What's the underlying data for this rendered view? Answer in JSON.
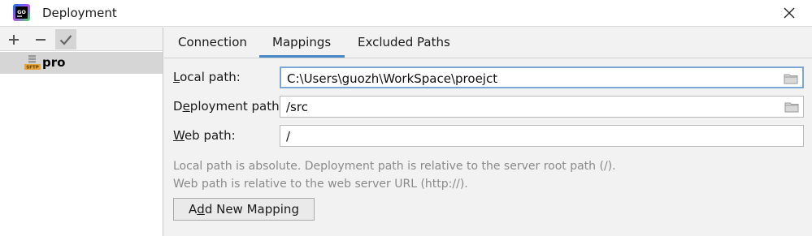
{
  "window": {
    "title": "Deployment",
    "logo_text": "GO",
    "close_icon": "close-icon"
  },
  "sidebar": {
    "toolbar": {
      "add_label": "+",
      "remove_label": "−"
    },
    "servers": [
      {
        "label": "pro",
        "badge": "SFTP"
      }
    ]
  },
  "tabs": [
    {
      "label": "Connection"
    },
    {
      "label": "Mappings"
    },
    {
      "label": "Excluded Paths"
    }
  ],
  "active_tab": "Mappings",
  "mappings": {
    "local_path": {
      "label_prefix": "",
      "mnemonic": "L",
      "label_rest": "ocal path:",
      "value": "C:\\Users\\guozh\\WorkSpace\\proejct"
    },
    "deployment_path": {
      "label_prefix": "D",
      "mnemonic": "e",
      "label_rest": "ployment path:",
      "value": "/src"
    },
    "web_path": {
      "label_prefix": "",
      "mnemonic": "W",
      "label_rest": "eb path:",
      "value": "/"
    },
    "help_line_1": "Local path is absolute. Deployment path is relative to the server root path (/).",
    "help_line_2": "Web path is relative to the web server URL (http://).",
    "add_button": {
      "prefix": "A",
      "mnemonic": "d",
      "rest": "d New Mapping"
    }
  },
  "colors": {
    "accent": "#4a89c8",
    "selection": "#d6d6d6",
    "sftp_badge": "#e8a33a"
  }
}
